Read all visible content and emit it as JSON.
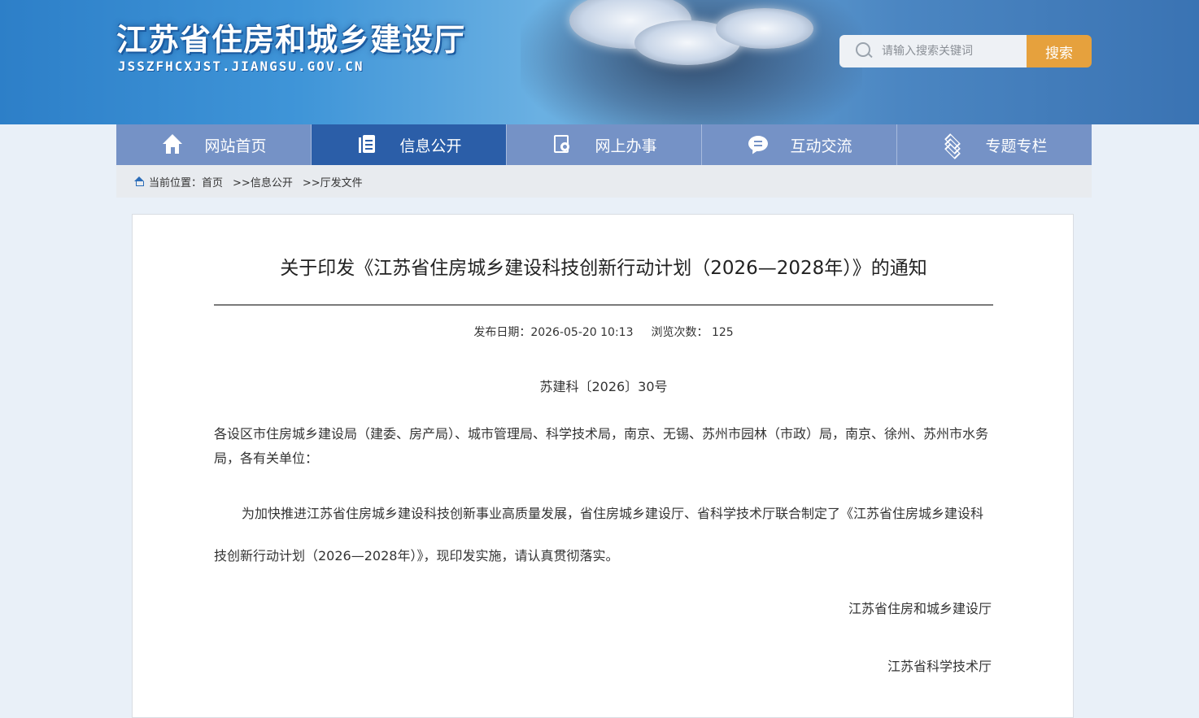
{
  "header": {
    "site_title": "江苏省住房和城乡建设厅",
    "site_domain": "JSSZFHCXJST.JIANGSU.GOV.CN",
    "search": {
      "placeholder": "请输入搜索关键词",
      "button_label": "搜索",
      "button_color": "#e6a13d"
    }
  },
  "nav": {
    "items": [
      {
        "label": "网站首页",
        "icon": "home-icon"
      },
      {
        "label": "信息公开",
        "icon": "document-icon",
        "active": true
      },
      {
        "label": "网上办事",
        "icon": "search-document-icon"
      },
      {
        "label": "互动交流",
        "icon": "chat-icon"
      },
      {
        "label": "专题专栏",
        "icon": "layers-icon"
      }
    ],
    "active_color": "#2b5ea8",
    "color": "#7592c6"
  },
  "breadcrumb": {
    "prefix": "当前位置：",
    "items": [
      "首页",
      ">>信息公开",
      ">>厅发文件"
    ]
  },
  "article": {
    "title": "关于印发《江苏省住房城乡建设科技创新行动计划（2026—2028年）》的通知",
    "meta": {
      "date": "发布日期：2026-05-20 10:13",
      "views": "浏览次数： 125"
    },
    "doc_number": "苏建科〔2026〕30号",
    "recipients": "各设区市住房城乡建设局（建委、房产局）、城市管理局、科学技术局，南京、无锡、苏州市园林（市政）局，南京、徐州、苏州市水务局，各有关单位：",
    "body": "为加快推进江苏省住房城乡建设科技创新事业高质量发展，省住房城乡建设厅、省科学技术厅联合制定了《江苏省住房城乡建设科技创新行动计划（2026—2028年）》，现印发实施，请认真贯彻落实。",
    "signatures": [
      "江苏省住房和城乡建设厅",
      "江苏省科学技术厅"
    ]
  }
}
